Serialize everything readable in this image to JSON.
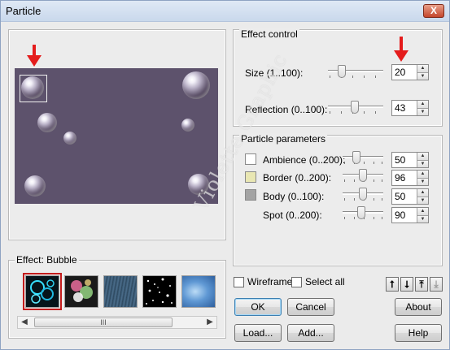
{
  "window": {
    "title": "Particle",
    "close_label": "X"
  },
  "preview": {
    "canvas_color": "#5d526c",
    "annotation_color": "#e41c1c"
  },
  "effect_group": {
    "label": "Effect: Bubble",
    "thumbnails": [
      {
        "name": "bubble",
        "selected": true
      },
      {
        "name": "glow",
        "selected": false
      },
      {
        "name": "rain",
        "selected": false
      },
      {
        "name": "stars",
        "selected": false
      },
      {
        "name": "cloud",
        "selected": false
      }
    ],
    "scroll_thumb_label": "III"
  },
  "effect_control": {
    "label": "Effect control",
    "size": {
      "label": "Size (1..100):",
      "value": "20"
    },
    "reflection": {
      "label": "Reflection (0..100):",
      "value": "43"
    }
  },
  "particle_parameters": {
    "label": "Particle parameters",
    "rows": [
      {
        "label": "Ambience (0..200):",
        "value": "50",
        "swatch": "#ffffff"
      },
      {
        "label": "Border (0..200):",
        "value": "96",
        "swatch": "#e9e7b3"
      },
      {
        "label": "Body (0..100):",
        "value": "50",
        "swatch": "#a3a3a3"
      },
      {
        "label": "Spot (0..200):",
        "value": "90",
        "swatch": null
      }
    ]
  },
  "options": {
    "wireframe": "Wireframe",
    "select_all": "Select all"
  },
  "buttons": {
    "ok": "OK",
    "cancel": "Cancel",
    "about": "About",
    "load": "Load...",
    "add": "Add...",
    "help": "Help"
  },
  "order_buttons": [
    "⭡",
    "⭣",
    "⤒",
    "⤓"
  ],
  "watermark": "Violette Graphic"
}
